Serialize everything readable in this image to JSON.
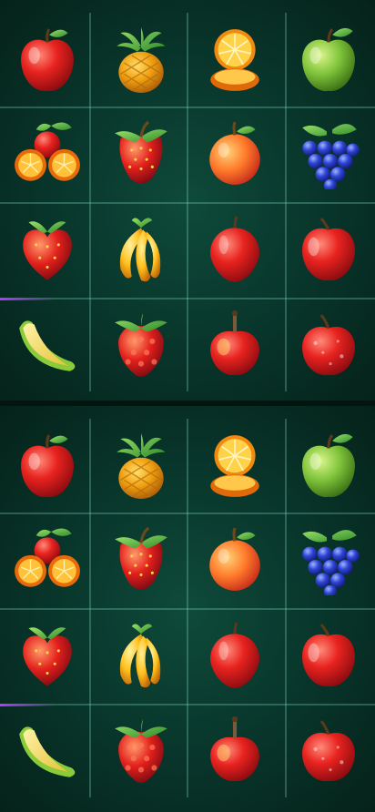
{
  "boards": [
    {
      "name": "top-board",
      "rows": [
        [
          "apple",
          "pineapple",
          "orange-slices",
          "green-apple"
        ],
        [
          "oranges-halves",
          "strawberry",
          "peach",
          "grapes"
        ],
        [
          "strawberry-heart",
          "banana-bunch",
          "red-plum",
          "red-apple"
        ],
        [
          "melon-slice",
          "raspberry",
          "apple-stem",
          "red-apple-shiny"
        ]
      ]
    },
    {
      "name": "bottom-board",
      "rows": [
        [
          "apple",
          "pineapple",
          "orange-slices",
          "green-apple"
        ],
        [
          "oranges-halves",
          "strawberry",
          "peach",
          "grapes"
        ],
        [
          "strawberry-heart",
          "banana-bunch",
          "red-plum",
          "red-apple"
        ],
        [
          "melon-slice",
          "raspberry",
          "apple-stem",
          "red-apple-shiny"
        ]
      ]
    }
  ],
  "colors": {
    "background": "#08342a",
    "grid_lines": "#8ce6c8",
    "accent_glow": "#b23cff"
  }
}
